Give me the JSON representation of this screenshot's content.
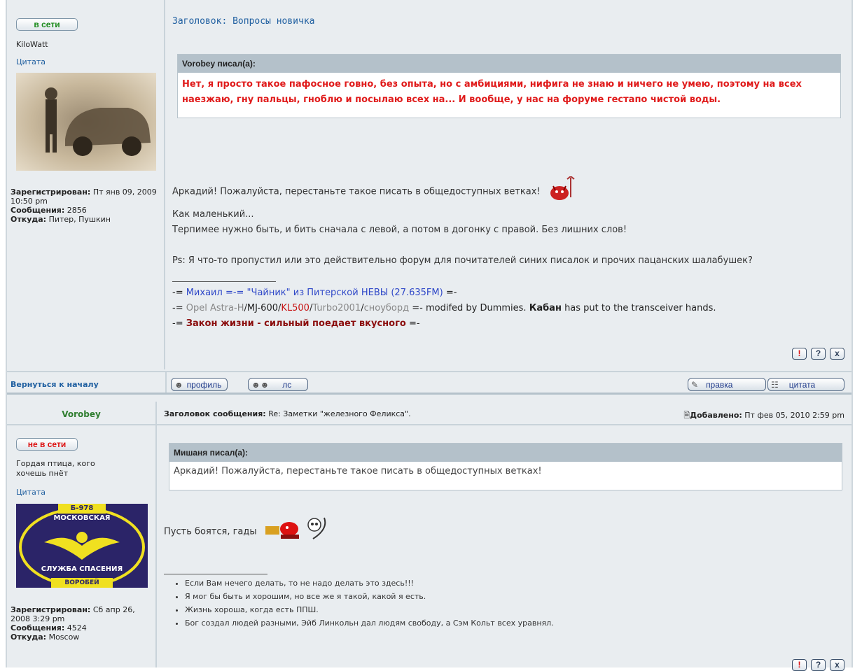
{
  "post1": {
    "status_label": "в сети",
    "username": "KiloWatt",
    "quote_link": "Цитата",
    "registered_label": "Зарегистрирован:",
    "registered_value": "Пт янв 09, 2009 10:50 pm",
    "posts_label": "Сообщения:",
    "posts_value": "2856",
    "from_label": "Откуда:",
    "from_value": "Питер, Пушкин",
    "subject": "Заголовок: Вопросы новичка",
    "quote_author": "Vorobey писал(а):",
    "quote_text": "Нет, я просто такое пафосное говно, без опыта, но с амбициями, нифига не знаю и ничего не умею, поэтому на всех наезжаю, гну пальцы, гноблю и посылаю всех на... И вообще, у нас на форуме гестапо чистой воды.",
    "message_lines": [
      "Аркадий! Пожалуйста, перестаньте такое писать в общедоступных ветках!",
      "Как маленький...",
      "Терпимее нужно быть, и бить сначала с левой, а потом в догонку с правой. Без лишних слов!",
      "",
      "Ps: Я что-то пропустил или это действительно форум для почитателей синих писалок и прочих пацанских шалабушек?"
    ],
    "signature": {
      "l1_prefix": "-= ",
      "l1_name": "Михаил",
      "l1_mid": " =-= \"Чайник\" из Питерской НЕВЫ (27.635FM)",
      "l1_suffix": " =-",
      "l2_prefix": "-= ",
      "l2_opel": "Opel Astra-H",
      "l2_slash1": "/",
      "l2_mj": "MJ-600",
      "l2_slash2": "/",
      "l2_kl": "KL500",
      "l2_slash3": "/",
      "l2_turbo": "Turbo2001",
      "l2_slash4": "/",
      "l2_snow": "сноуборд",
      "l2_rest1": " =- modifed by Dummies. ",
      "l2_kaban": "Кабан",
      "l2_rest2": " has put to the transceiver hands.",
      "l3_prefix": "-= ",
      "l3_text": "Закон жизни - сильный поедает вкусного",
      "l3_suffix": " =-"
    },
    "report_icons": [
      "!",
      "?",
      "x"
    ]
  },
  "bar": {
    "back_link": "Вернуться к началу",
    "profile_btn": "профиль",
    "pm_btn": "лс",
    "edit_btn": "правка",
    "quote_btn": "цитата"
  },
  "post2": {
    "author": "Vorobey",
    "subject_label": "Заголовок сообщения:",
    "subject_value": "Re: Заметки \"железного Феликса\".",
    "added_label": "Добавлено:",
    "added_value": "Пт фев 05, 2010 2:59 pm",
    "status_label": "не в сети",
    "user_title": "Гордая птица, кого хочешь пнёт",
    "quote_link": "Цитата",
    "avatar_text_top": "Б-978",
    "avatar_text_1": "МОСКОВСКАЯ",
    "avatar_text_2": "СЛУЖБА СПАСЕНИЯ",
    "avatar_text_3": "ВОРОБЕЙ",
    "registered_label": "Зарегистрирован:",
    "registered_value": "Сб апр 26, 2008 3:29 pm",
    "posts_label": "Сообщения:",
    "posts_value": "4524",
    "from_label": "Откуда:",
    "from_value": "Moscow",
    "quote_author": "Мишаня писал(а):",
    "quote_text": "Аркадий! Пожалуйста, перестаньте такое писать в общедоступных ветках!",
    "message": "Пусть боятся, гады",
    "bullets": [
      "Если Вам нечего делать, то не надо делать это здесь!!!",
      "Я мог бы быть и хорошим, но все же я такой, какой я есть.",
      "Жизнь хороша, когда есть ППШ.",
      "Бог создал людей разными, Эйб Линкольн дал людям свободу, а Сэм Кольт всех уравнял."
    ],
    "report_icons": [
      "!",
      "?",
      "x"
    ]
  }
}
